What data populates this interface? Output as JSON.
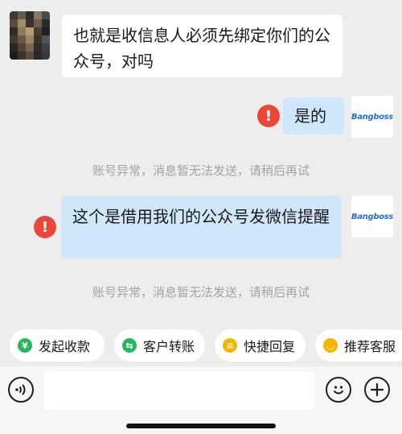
{
  "messages": [
    {
      "side": "left",
      "text": "也就是收信息人必须先绑定你们的公众号，对吗"
    },
    {
      "side": "right",
      "text": "是的",
      "failed": true
    },
    {
      "side": "right",
      "text": "这个是借用我们的公众号发微信提醒",
      "failed": true
    }
  ],
  "error_glyph": "!",
  "avatar_logo": "Bangboss",
  "notices": [
    "账号异常，消息暂无法发送，请稍后再试",
    "账号异常，消息暂无法发送，请稍后再试"
  ],
  "quick_actions": [
    {
      "label": "发起收款",
      "icon": "yuan-icon",
      "glyph": "¥",
      "color": "#2cb35d"
    },
    {
      "label": "客户转账",
      "icon": "transfer-icon",
      "glyph": "⇆",
      "color": "#2cb35d"
    },
    {
      "label": "快捷回复",
      "icon": "quick-reply-icon",
      "glyph": "≡",
      "color": "#f4b400"
    },
    {
      "label": "推荐客服",
      "icon": "recommend-icon",
      "glyph": "◡",
      "color": "#f4b400"
    }
  ],
  "input": {
    "placeholder": "",
    "value": ""
  },
  "colors": {
    "background": "#ededed",
    "bubble_blue": "#cfe6fb",
    "error": "#e8473b"
  }
}
